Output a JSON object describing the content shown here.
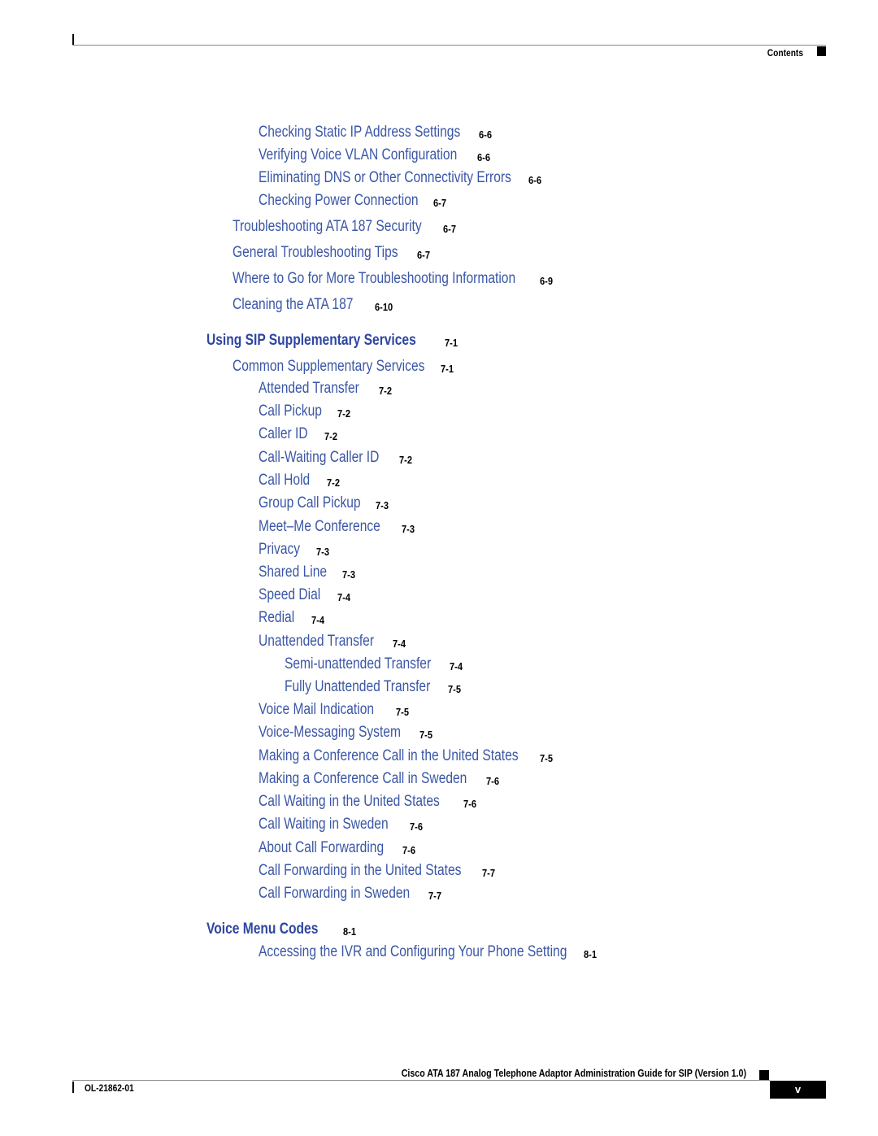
{
  "header": {
    "section_label": "Contents"
  },
  "toc": [
    {
      "level": 3,
      "title": "Checking Static IP Address Settings",
      "page": "6-6"
    },
    {
      "level": 3,
      "title": "Verifying Voice VLAN Configuration",
      "page": "6-6"
    },
    {
      "level": 3,
      "title": "Eliminating DNS or Other Connectivity Errors",
      "page": "6-6"
    },
    {
      "level": 3,
      "title": "Checking Power Connection",
      "page": "6-7"
    },
    {
      "level": 2,
      "title": "Troubleshooting ATA 187 Security",
      "page": "6-7"
    },
    {
      "level": 2,
      "title": "General Troubleshooting Tips",
      "page": "6-7"
    },
    {
      "level": 2,
      "title": "Where to Go for More Troubleshooting Information",
      "page": "6-9"
    },
    {
      "level": 2,
      "title": "Cleaning the ATA 187",
      "page": "6-10"
    },
    {
      "level": 1,
      "title": "Using SIP Supplementary Services",
      "page": "7-1"
    },
    {
      "level": 2,
      "title": "Common Supplementary Services",
      "page": "7-1"
    },
    {
      "level": 3,
      "title": "Attended Transfer",
      "page": "7-2"
    },
    {
      "level": 3,
      "title": "Call Pickup",
      "page": "7-2"
    },
    {
      "level": 3,
      "title": "Caller ID",
      "page": "7-2"
    },
    {
      "level": 3,
      "title": "Call-Waiting Caller ID",
      "page": "7-2"
    },
    {
      "level": 3,
      "title": "Call Hold",
      "page": "7-2"
    },
    {
      "level": 3,
      "title": "Group Call Pickup",
      "page": "7-3"
    },
    {
      "level": 3,
      "title": "Meet–Me Conference",
      "page": "7-3"
    },
    {
      "level": 3,
      "title": "Privacy",
      "page": "7-3"
    },
    {
      "level": 3,
      "title": "Shared Line",
      "page": "7-3"
    },
    {
      "level": 3,
      "title": "Speed Dial",
      "page": "7-4"
    },
    {
      "level": 3,
      "title": "Redial",
      "page": "7-4"
    },
    {
      "level": 3,
      "title": "Unattended Transfer",
      "page": "7-4"
    },
    {
      "level": 4,
      "title": "Semi-unattended Transfer",
      "page": "7-4"
    },
    {
      "level": 4,
      "title": "Fully Unattended Transfer",
      "page": "7-5"
    },
    {
      "level": 3,
      "title": "Voice Mail Indication",
      "page": "7-5"
    },
    {
      "level": 3,
      "title": "Voice-Messaging System",
      "page": "7-5"
    },
    {
      "level": 3,
      "title": "Making a Conference Call in the United States",
      "page": "7-5"
    },
    {
      "level": 3,
      "title": "Making a Conference Call in Sweden",
      "page": "7-6"
    },
    {
      "level": 3,
      "title": "Call Waiting in the United States",
      "page": "7-6"
    },
    {
      "level": 3,
      "title": "Call Waiting in Sweden",
      "page": "7-6"
    },
    {
      "level": 3,
      "title": "About Call Forwarding",
      "page": "7-6"
    },
    {
      "level": 3,
      "title": "Call Forwarding in the United States",
      "page": "7-7"
    },
    {
      "level": 3,
      "title": "Call Forwarding in Sweden",
      "page": "7-7"
    },
    {
      "level": 1,
      "title": "Voice Menu Codes",
      "page": "8-1"
    },
    {
      "level": 3,
      "title": "Accessing the IVR and Configuring Your Phone Setting",
      "page": "8-1"
    }
  ],
  "footer": {
    "guide_title": "Cisco ATA 187 Analog Telephone Adaptor Administration Guide for SIP (Version 1.0)",
    "doc_number": "OL-21862-01",
    "page_number": "v"
  },
  "colors": {
    "link": "#3a56a6",
    "chapter": "#2e46a0",
    "page_ref": "#000000"
  }
}
